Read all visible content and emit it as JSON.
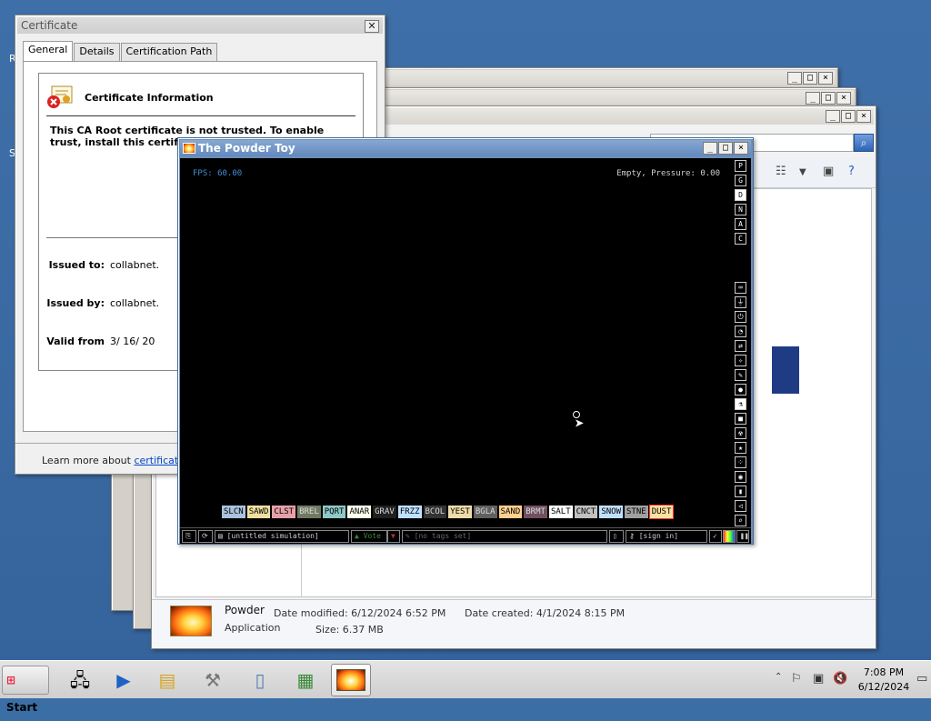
{
  "colors": {
    "desktop": "#3a6ea5",
    "pt_title": "#6d8fb9",
    "link": "#0044cc"
  },
  "certificate": {
    "title": "Certificate",
    "close": "✕",
    "tabs": [
      "General",
      "Details",
      "Certification Path"
    ],
    "heading": "Certificate Information",
    "warning": "This CA Root certificate is not trusted. To enable trust, install this certificate in t Authorities store.",
    "issued_to_label": "Issued to:",
    "issued_to_value": "collabnet.",
    "issued_by_label": "Issued by:",
    "issued_by_value": "collabnet.",
    "valid_from_label": "Valid from",
    "valid_from_value": "3/ 16/ 20",
    "learn_prefix": "Learn more about ",
    "learn_link": "certificates"
  },
  "powder_toy": {
    "title": "The Powder Toy",
    "fps": "FPS: 60.00",
    "status": "Empty, Pressure: 0.00",
    "side_top": [
      "P",
      "G",
      "D",
      "N",
      "A",
      "C"
    ],
    "side_selected": "D",
    "side_bottom_icons": [
      "keyboard-icon",
      "plug-icon",
      "power-icon",
      "gauge-icon",
      "arrows-icon",
      "spray-icon",
      "brush-icon",
      "drop-icon",
      "flask-icon",
      "square-icon",
      "radiation-icon",
      "star-icon",
      "dots-icon",
      "bulb-icon",
      "bookmark-icon",
      "sound-icon",
      "search-icon"
    ],
    "elements": [
      {
        "label": "SLCN",
        "color": "#a9c2de"
      },
      {
        "label": "SAWD",
        "color": "#f0e0a0"
      },
      {
        "label": "CLST",
        "color": "#e8a0a8"
      },
      {
        "label": "BREL",
        "color": "#707a62"
      },
      {
        "label": "PQRT",
        "color": "#90c8c8"
      },
      {
        "label": "ANAR",
        "color": "#ffffee"
      },
      {
        "label": "GRAV",
        "color": "#202020"
      },
      {
        "label": "FRZZ",
        "color": "#c0e0ff"
      },
      {
        "label": "BCOL",
        "color": "#333333"
      },
      {
        "label": "YEST",
        "color": "#eeddaa"
      },
      {
        "label": "BGLA",
        "color": "#606060"
      },
      {
        "label": "SAND",
        "color": "#ffd090"
      },
      {
        "label": "BRMT",
        "color": "#705060"
      },
      {
        "label": "SALT",
        "color": "#ffffff"
      },
      {
        "label": "CNCT",
        "color": "#c0c0c0"
      },
      {
        "label": "SNOW",
        "color": "#c0e0ff"
      },
      {
        "label": "STNE",
        "color": "#a0a0a0"
      },
      {
        "label": "DUST",
        "color": "#ffe0a0"
      }
    ],
    "sim_name": "[untitled simulation]",
    "vote": "Vote",
    "tags": "[no tags set]",
    "signin": "[sign in]"
  },
  "explorer": {
    "file_name": "Powder",
    "file_type": "Application",
    "date_modified": "Date modified: 6/12/2024 6:52 PM",
    "size": "Size: 6.37 MB",
    "date_created": "Date created: 4/1/2024 8:15 PM"
  },
  "taskbar": {
    "start": "Start",
    "time": "7:08 PM",
    "date": "6/12/2024"
  }
}
